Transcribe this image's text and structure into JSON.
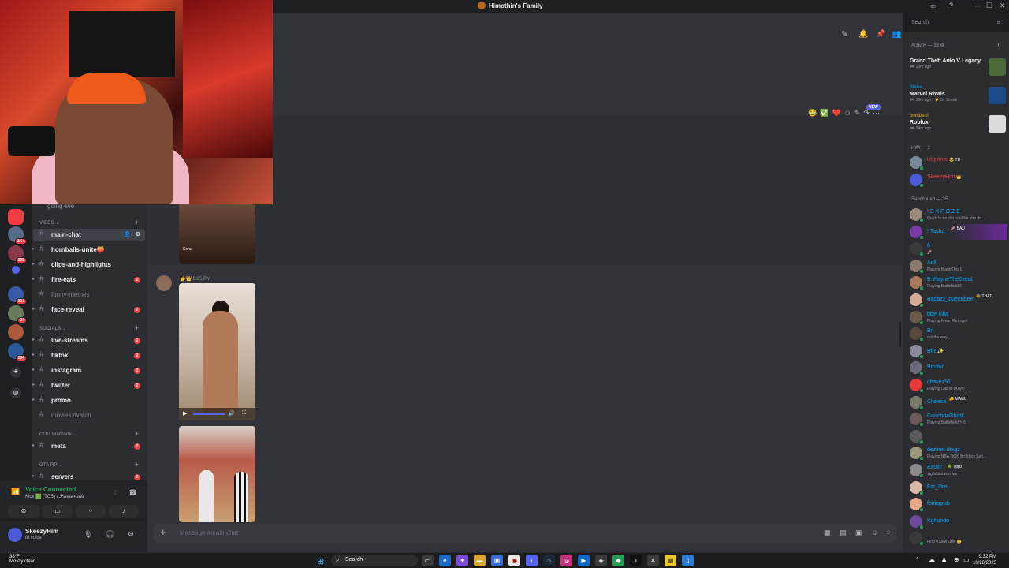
{
  "window": {
    "title": "Himothin's Family",
    "minimize": "—",
    "maximize": "☐",
    "close": "✕"
  },
  "header": {
    "search_placeholder": "Search"
  },
  "sidebar": {
    "clipped_channel": "going-live",
    "categories": [
      {
        "label": "VIBES ⌄"
      },
      {
        "label": "SOCIALS ⌄"
      },
      {
        "label": "COD Warzone ⌄"
      },
      {
        "label": "GTA RP ⌄"
      }
    ],
    "channels": [
      {
        "name": "main-chat",
        "state": "selected",
        "icon": "👤+ ⚙"
      },
      {
        "name": "hornballs-unite🍑",
        "state": "unread"
      },
      {
        "name": "clips-and-highlights",
        "state": "unread"
      },
      {
        "name": "fire-eats",
        "state": "unread",
        "count": "2"
      },
      {
        "name": "funny-memes",
        "state": "muted"
      },
      {
        "name": "face-reveal",
        "state": "unread",
        "count": "2"
      },
      {
        "name": "live-streams",
        "state": "unread",
        "count": "2"
      },
      {
        "name": "tiktok",
        "state": "unread",
        "count": "2"
      },
      {
        "name": "instagram",
        "state": "unread",
        "count": "2"
      },
      {
        "name": "twitter",
        "state": "unread",
        "count": "2"
      },
      {
        "name": "promo",
        "state": "unread"
      },
      {
        "name": "movies2watch",
        "state": "muted"
      },
      {
        "name": "meta",
        "state": "unread",
        "count": "2"
      },
      {
        "name": "servers",
        "state": "unread",
        "count": "2"
      }
    ],
    "guild_badges": [
      "1K+",
      "335",
      "201",
      "24",
      "204"
    ]
  },
  "voice": {
    "status": "Voice Connected",
    "channel": "Kick 🟩 (TOS) / 𝓟𝓻𝓲𝓶𝓮𝓥𝓲𝓵𝓵𝓮"
  },
  "user": {
    "name": "SkeezyHim",
    "status": "In voice"
  },
  "chat": {
    "new_tag": "NEW",
    "media1_label": "Sora",
    "message_time": "6:25 PM",
    "composer_placeholder": "Message #main-chat"
  },
  "members": {
    "activity_header": "Activity — 33 ⚙",
    "activities": [
      {
        "user": "",
        "game": "Grand Theft Auto V Legacy",
        "time": "🎮 10m ago",
        "art_color": "#4a6a3a"
      },
      {
        "user": "Blaise",
        "game": "Marvel Rivals",
        "time": "🎮 16m ago · ⚡ 5x Streak",
        "art_color": "#1a4a8a"
      },
      {
        "user": "bomberri",
        "game": "Roblox",
        "time": "🎮 34m ago",
        "art_color": "#dcdcdc"
      }
    ],
    "him_header": "HIM — 2",
    "him": [
      {
        "name": "izi prime",
        "tag": "😎 TD",
        "color": "#f23f43"
      },
      {
        "name": "SkeezyHim",
        "tag": "👑",
        "color": "#f23f43"
      }
    ],
    "sanctioned_header": "Sanctioned — 35",
    "sanctioned": [
      {
        "name": "! E X P O Z E",
        "sub": "Quick to treat a hoe like she do...",
        "color": "#00a8fc"
      },
      {
        "name": "! Tasha",
        "sub": "",
        "color": "#00a8fc"
      },
      {
        "name": "6",
        "sub": "🚀",
        "color": "#00a8fc"
      },
      {
        "name": "Arill",
        "sub": "Playing Black Ops 6",
        "color": "#00a8fc"
      },
      {
        "name": "B WayneTheGreat",
        "sub": "Playing Battlefield 6",
        "color": "#00a8fc"
      },
      {
        "name": "Badazz_queenbee",
        "sub": "",
        "color": "#00a8fc"
      },
      {
        "name": "bbw killa",
        "sub": "Playing Arena Reforger",
        "color": "#00a8fc"
      },
      {
        "name": "Bri.",
        "sub": "out the way...",
        "color": "#00a8fc"
      },
      {
        "name": "Brie✨",
        "sub": "",
        "color": "#00a8fc"
      },
      {
        "name": "Brodor",
        "sub": "",
        "color": "#00a8fc"
      },
      {
        "name": "chavez91",
        "sub": "Playing Call of Duty®",
        "color": "#00a8fc"
      },
      {
        "name": "Cheese",
        "sub": "",
        "color": "#00a8fc"
      },
      {
        "name": "CoachdaGhost",
        "sub": "Playing Battlefield™ 6",
        "color": "#00a8fc"
      },
      {
        "name": "",
        "sub": "",
        "color": "#f23f43"
      },
      {
        "name": "deziner drxgz",
        "sub": "Playing NBA 2K26 for Xbox Seri...",
        "color": "#00a8fc"
      },
      {
        "name": "Exotic",
        "sub": "",
        "color": "#00a8fc"
      },
      {
        "name": "Fat_Dre",
        "sub": "",
        "color": "#00a8fc"
      },
      {
        "name": "foirisgrub",
        "sub": "",
        "color": "#00a8fc"
      },
      {
        "name": "Kghundo",
        "sub": "",
        "color": "#00a8fc"
      },
      {
        "name": "",
        "sub": "Find A New One 😊",
        "color": "#f23f43"
      }
    ],
    "tags": {
      "tasha": "🚀 BAU",
      "badazz": "🐝 THAT",
      "cheese": "🧀 MANU",
      "exotic": "🍀 oppz",
      "exotic_sub": ".gg/atlantastories"
    }
  },
  "taskbar": {
    "temp": "38°F",
    "weather": "Mostly clear",
    "search": "Search",
    "time": "9:32 PM",
    "date": "10/26/2025"
  }
}
